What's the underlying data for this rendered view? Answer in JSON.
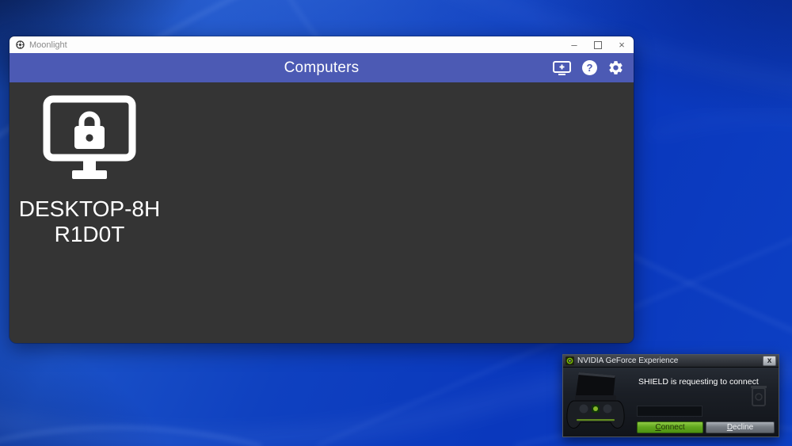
{
  "wallpaper": {
    "base_color": "#0a38bd",
    "highlight_color": "#2f6ae0",
    "shadow_color": "#062060"
  },
  "moonlight_window": {
    "titlebar": {
      "app_name": "Moonlight",
      "minimize_glyph": "–",
      "close_glyph": "×"
    },
    "header": {
      "title": "Computers",
      "accent_color": "#4c5ab4",
      "help_glyph": "?",
      "icons": [
        "add-computer",
        "help",
        "settings"
      ]
    },
    "content": {
      "background_color": "#343434",
      "computer": {
        "name": "DESKTOP-8HR1D0T",
        "name_line1": "DESKTOP-8H",
        "name_line2": "R1D0T",
        "status": "locked"
      }
    }
  },
  "nvidia_dialog": {
    "title": "NVIDIA GeForce Experience",
    "close_glyph": "x",
    "message": "SHIELD is requesting to connect",
    "pin_field_value": "",
    "brand_green": "#76b900",
    "buttons": {
      "connect_initial": "C",
      "connect_rest": "onnect",
      "decline_initial": "D",
      "decline_rest": "ecline"
    }
  }
}
